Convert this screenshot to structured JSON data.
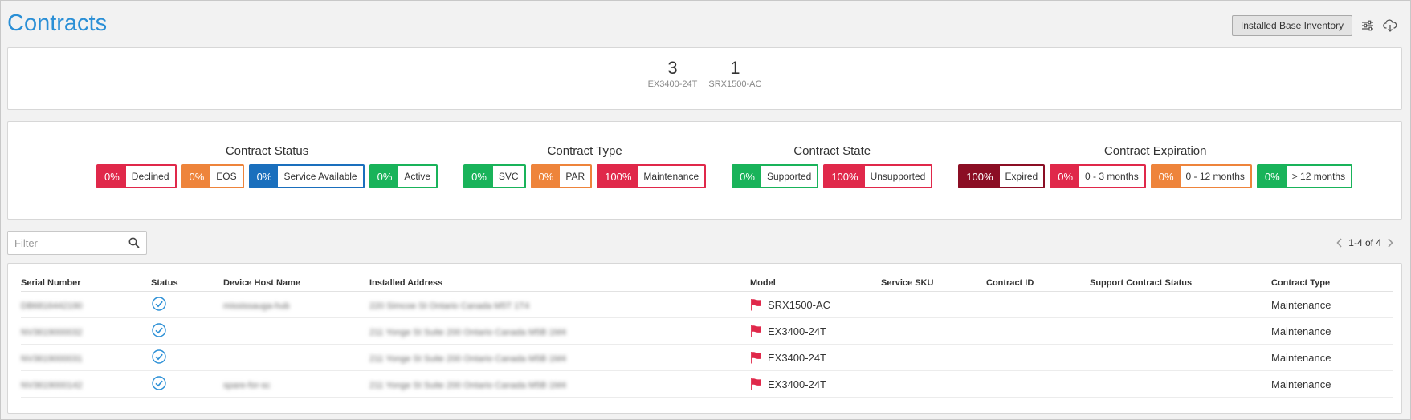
{
  "header": {
    "title": "Contracts",
    "installed_base_label": "Installed Base Inventory",
    "settings_icon": "sliders-icon",
    "download_icon": "cloud-download-icon"
  },
  "summary": {
    "items": [
      {
        "count": "3",
        "model": "EX3400-24T"
      },
      {
        "count": "1",
        "model": "SRX1500-AC"
      }
    ]
  },
  "colors": {
    "red": "#e0284a",
    "orange": "#ee843b",
    "blue": "#1a6fbd",
    "green": "#19b35a",
    "darkred": "#8b0e24",
    "title": "#2a8fd6"
  },
  "status_groups": [
    {
      "title": "Contract Status",
      "pills": [
        {
          "pct": "0%",
          "label": "Declined",
          "color": "#e0284a"
        },
        {
          "pct": "0%",
          "label": "EOS",
          "color": "#ee843b"
        },
        {
          "pct": "0%",
          "label": "Service Available",
          "color": "#1a6fbd"
        },
        {
          "pct": "0%",
          "label": "Active",
          "color": "#19b35a"
        }
      ]
    },
    {
      "title": "Contract Type",
      "pills": [
        {
          "pct": "0%",
          "label": "SVC",
          "color": "#19b35a"
        },
        {
          "pct": "0%",
          "label": "PAR",
          "color": "#ee843b"
        },
        {
          "pct": "100%",
          "label": "Maintenance",
          "color": "#e0284a"
        }
      ]
    },
    {
      "title": "Contract State",
      "pills": [
        {
          "pct": "0%",
          "label": "Supported",
          "color": "#19b35a"
        },
        {
          "pct": "100%",
          "label": "Unsupported",
          "color": "#e0284a"
        }
      ]
    },
    {
      "title": "Contract Expiration",
      "pills": [
        {
          "pct": "100%",
          "label": "Expired",
          "color": "#8b0e24"
        },
        {
          "pct": "0%",
          "label": "0 - 3 months",
          "color": "#e0284a"
        },
        {
          "pct": "0%",
          "label": "0 - 12 months",
          "color": "#ee843b"
        },
        {
          "pct": "0%",
          "label": "> 12 months",
          "color": "#19b35a"
        }
      ]
    }
  ],
  "filter": {
    "placeholder": "Filter",
    "value": ""
  },
  "pager": {
    "text": "1-4 of 4"
  },
  "table": {
    "columns": [
      "Serial Number",
      "Status",
      "Device Host Name",
      "Installed Address",
      "Model",
      "Service SKU",
      "Contract ID",
      "Support Contract Status",
      "Contract Type"
    ],
    "rows": [
      {
        "serial": "DB6816442190",
        "status_icon": "check-circle-icon",
        "host": "mississauga-hub",
        "address": "220 Simcoe St Ontario Canada M5T 1T4",
        "model": "SRX1500-AC",
        "sku": "",
        "contract_id": "",
        "support_status": "",
        "contract_type": "Maintenance"
      },
      {
        "serial": "NV3619000032",
        "status_icon": "check-circle-icon",
        "host": "",
        "address": "211 Yonge St Suite 200 Ontario Canada M5B 1M4",
        "model": "EX3400-24T",
        "sku": "",
        "contract_id": "",
        "support_status": "",
        "contract_type": "Maintenance"
      },
      {
        "serial": "NV3619000031",
        "status_icon": "check-circle-icon",
        "host": "",
        "address": "211 Yonge St Suite 200 Ontario Canada M5B 1M4",
        "model": "EX3400-24T",
        "sku": "",
        "contract_id": "",
        "support_status": "",
        "contract_type": "Maintenance"
      },
      {
        "serial": "NV3619000142",
        "status_icon": "check-circle-icon",
        "host": "spare-for-sc",
        "address": "211 Yonge St Suite 200 Ontario Canada M5B 1M4",
        "model": "EX3400-24T",
        "sku": "",
        "contract_id": "",
        "support_status": "",
        "contract_type": "Maintenance"
      }
    ]
  }
}
